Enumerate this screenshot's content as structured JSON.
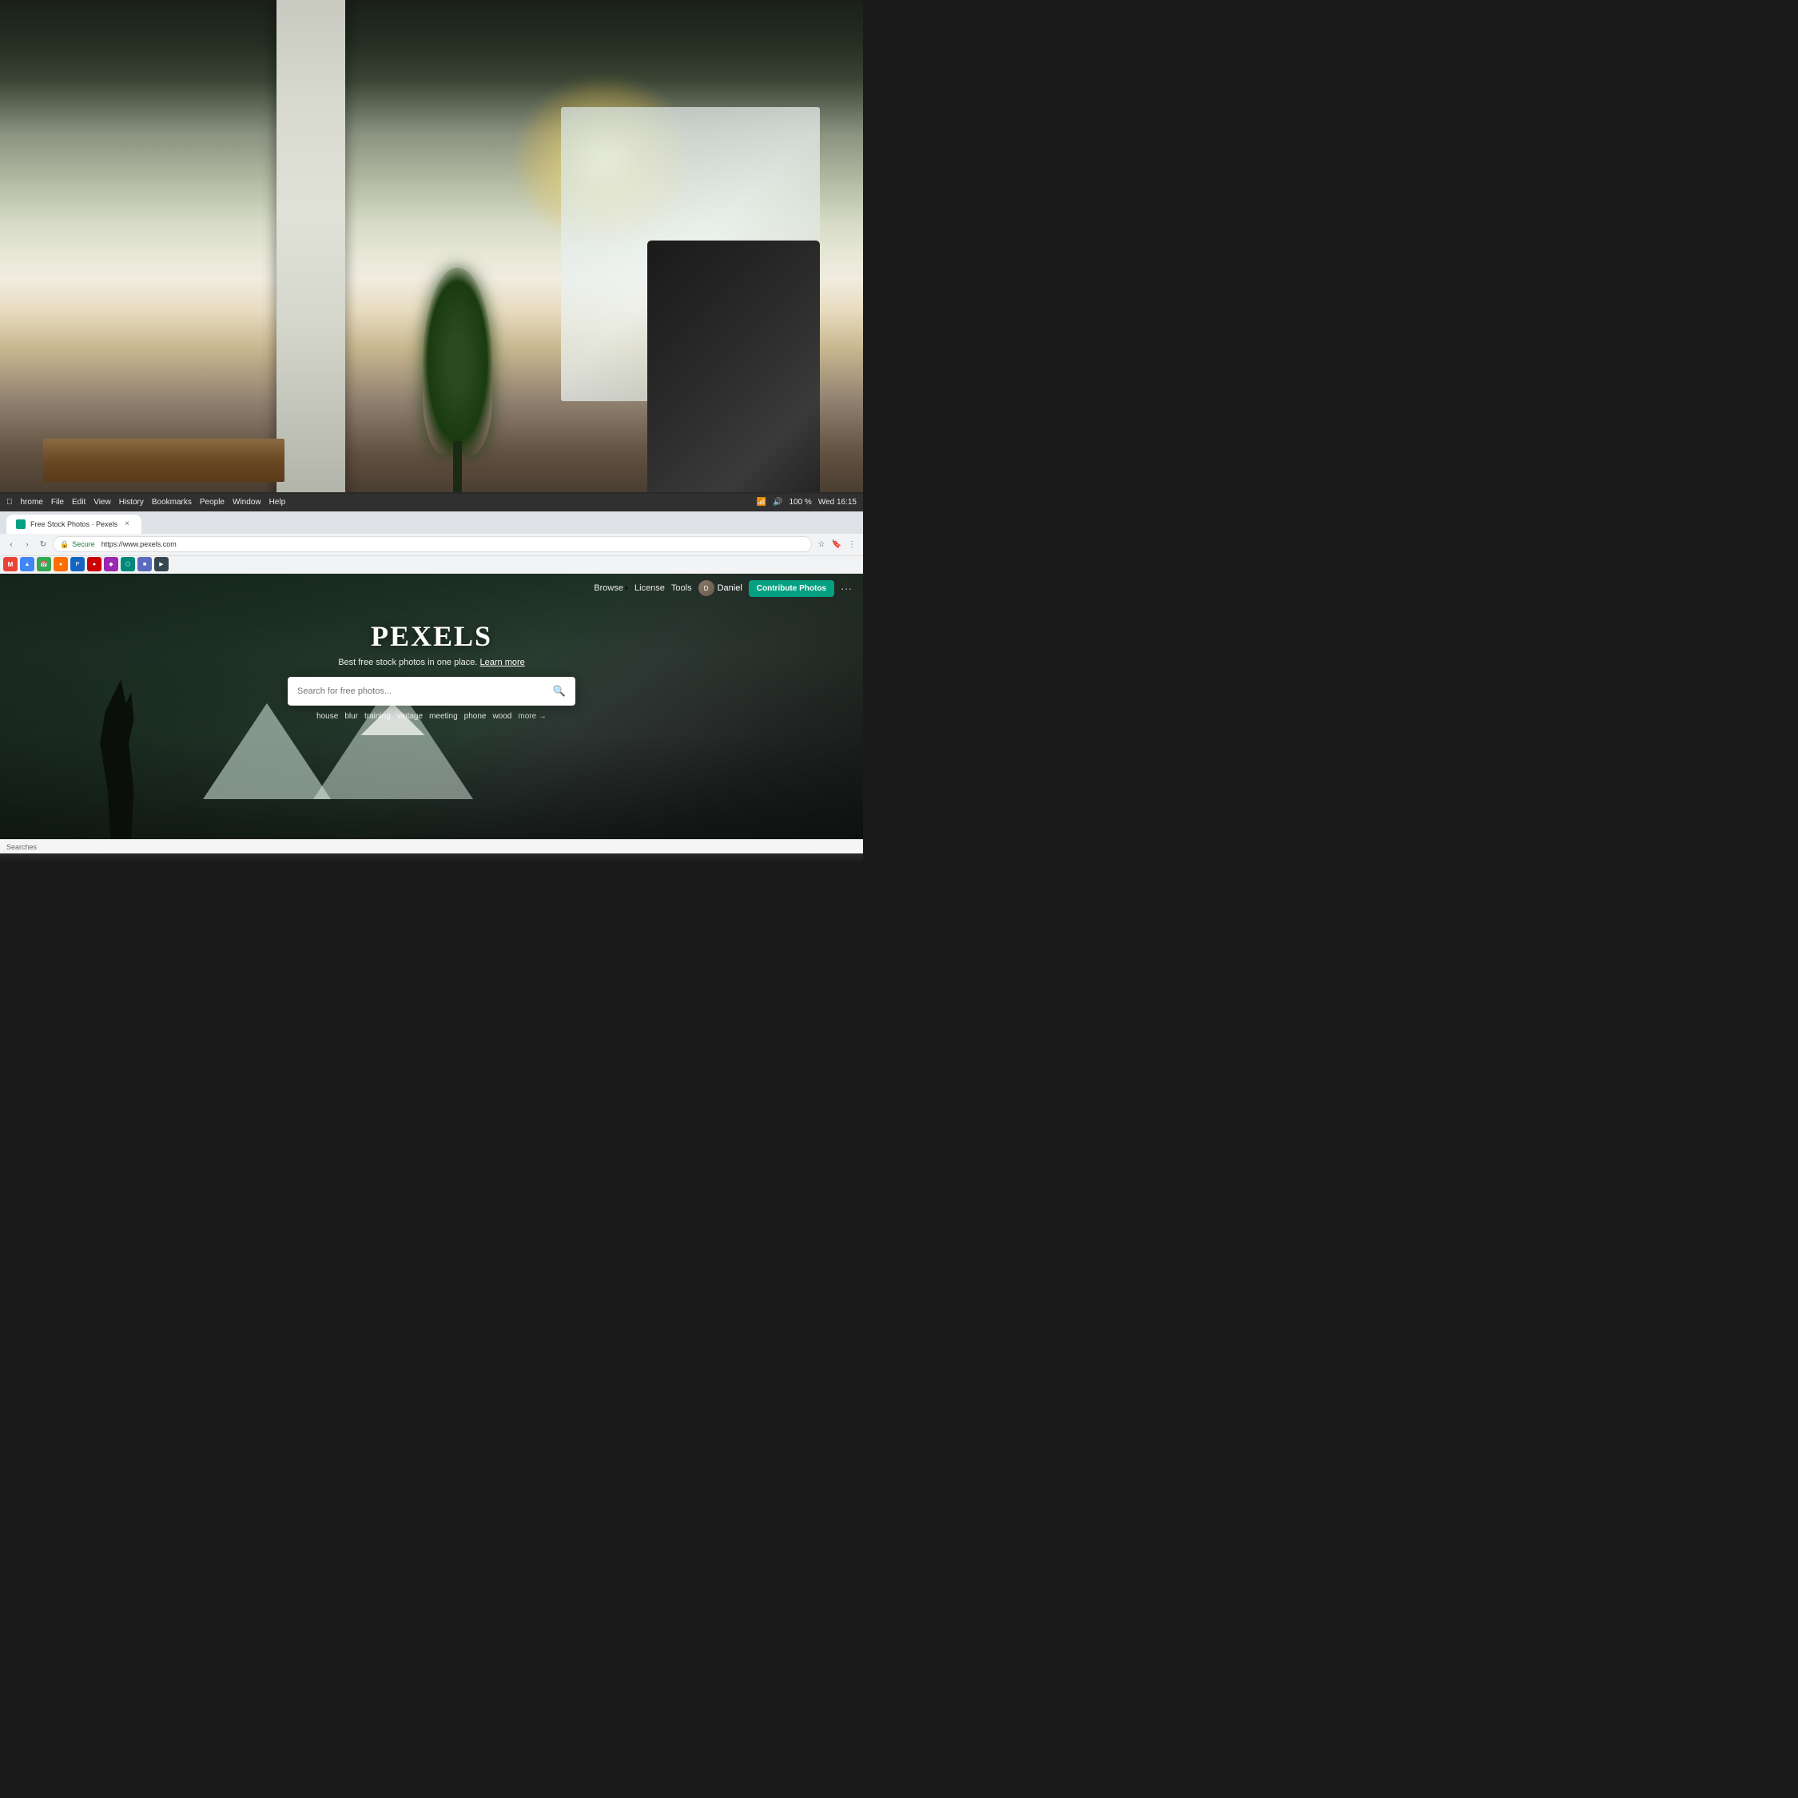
{
  "page": {
    "title": "Pexels - Free Stock Photos",
    "url": "https://www.pexels.com",
    "secure_label": "Secure",
    "time": "Wed 16:15",
    "battery": "100 %"
  },
  "browser": {
    "tab_title": "Free Stock Photos · Pexels",
    "url_display": "https://www.pexels.com",
    "menu_items": [
      "hrome",
      "File",
      "Edit",
      "View",
      "History",
      "Bookmarks",
      "People",
      "Window",
      "Help"
    ],
    "close_label": "×"
  },
  "pexels": {
    "brand": "PEXELS",
    "tagline": "Best free stock photos in one place.",
    "learn_more": "Learn more",
    "search_placeholder": "Search for free photos...",
    "nav": {
      "browse": "Browse",
      "license": "License",
      "tools": "Tools",
      "user": "Daniel",
      "contribute": "Contribute Photos",
      "more": "···"
    },
    "search_tags": [
      "house",
      "blur",
      "training",
      "vintage",
      "meeting",
      "phone",
      "wood",
      "more →"
    ]
  },
  "status_bar": {
    "text": "Searches"
  },
  "icons": {
    "search": "🔍",
    "user": "👤",
    "star": "☆",
    "shield": "🔒",
    "chevron_down": "▾",
    "arrow_right": "→"
  }
}
